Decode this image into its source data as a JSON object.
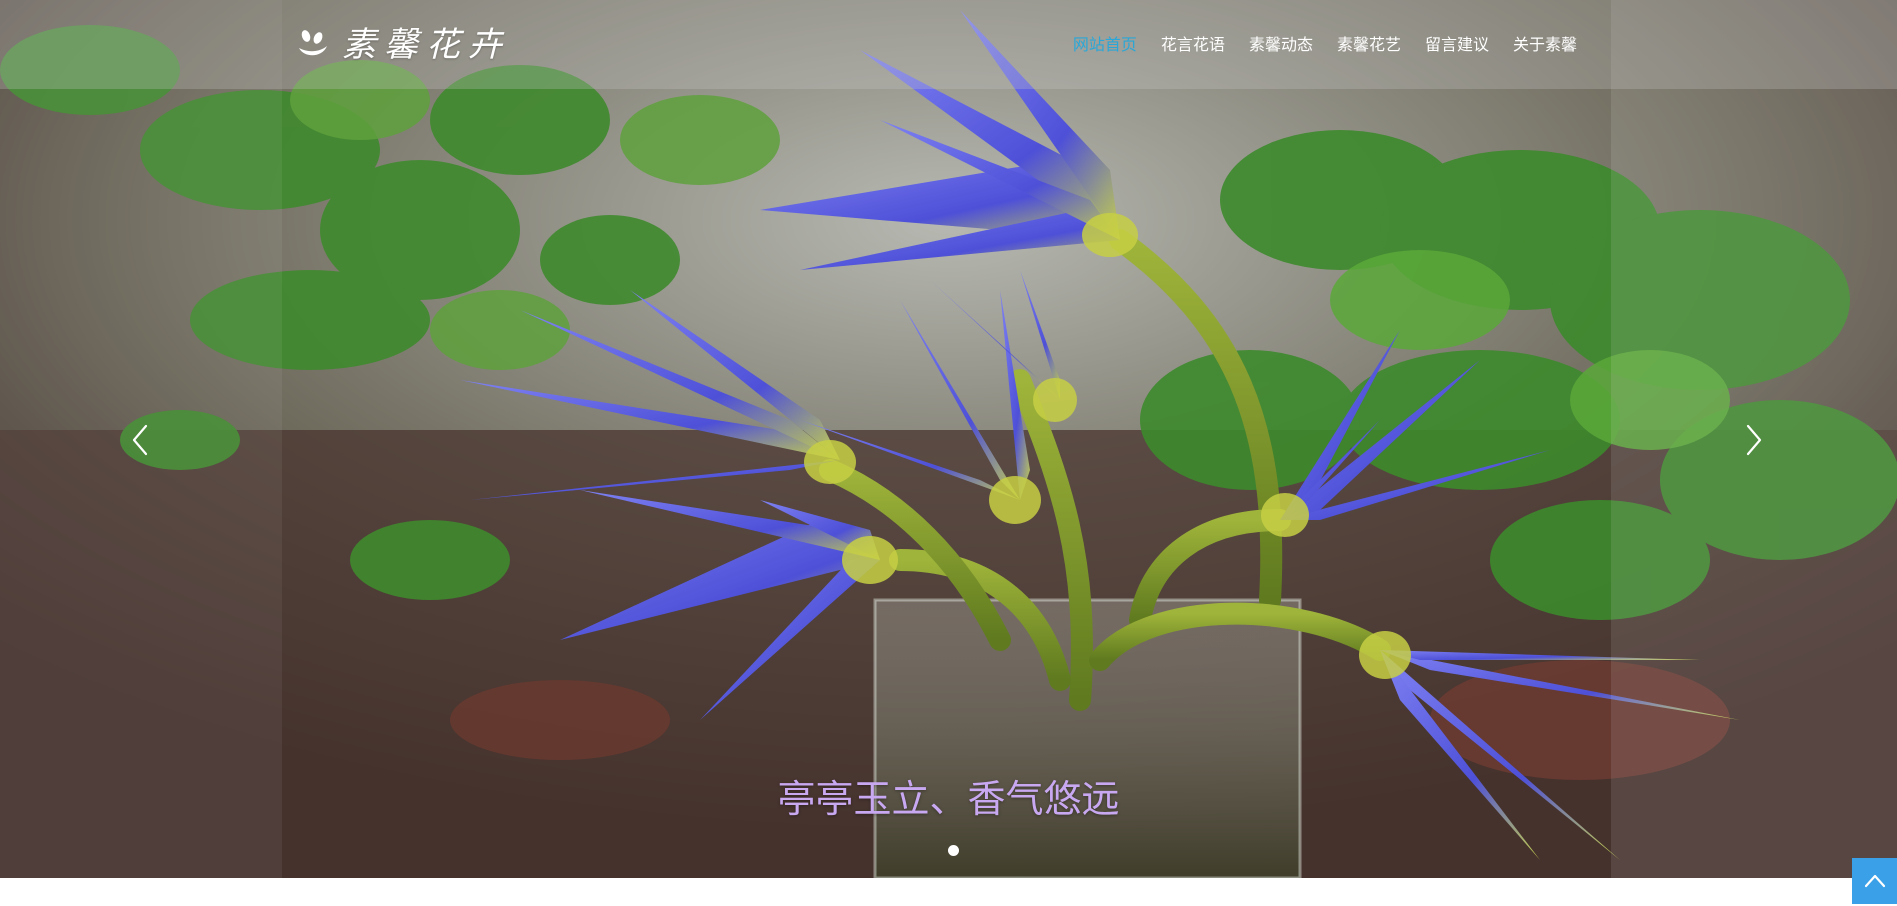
{
  "header": {
    "logo_text": "素馨花卉",
    "nav": [
      {
        "label": "网站首页",
        "active": true
      },
      {
        "label": "花言花语",
        "active": false
      },
      {
        "label": "素馨动态",
        "active": false
      },
      {
        "label": "素馨花艺",
        "active": false
      },
      {
        "label": "留言建议",
        "active": false
      },
      {
        "label": "关于素馨",
        "active": false
      }
    ]
  },
  "carousel": {
    "caption": "亭亭玉立、香气悠远",
    "slide_count": 1,
    "active_slide": 1,
    "prev_icon": "chevron-left-icon",
    "next_icon": "chevron-right-icon"
  },
  "back_to_top": {
    "icon": "chevron-up-icon"
  },
  "colors": {
    "nav_active": "#2aa7d8",
    "caption": "#c9a8f2",
    "back_to_top_bg": "#3aa0e8"
  }
}
